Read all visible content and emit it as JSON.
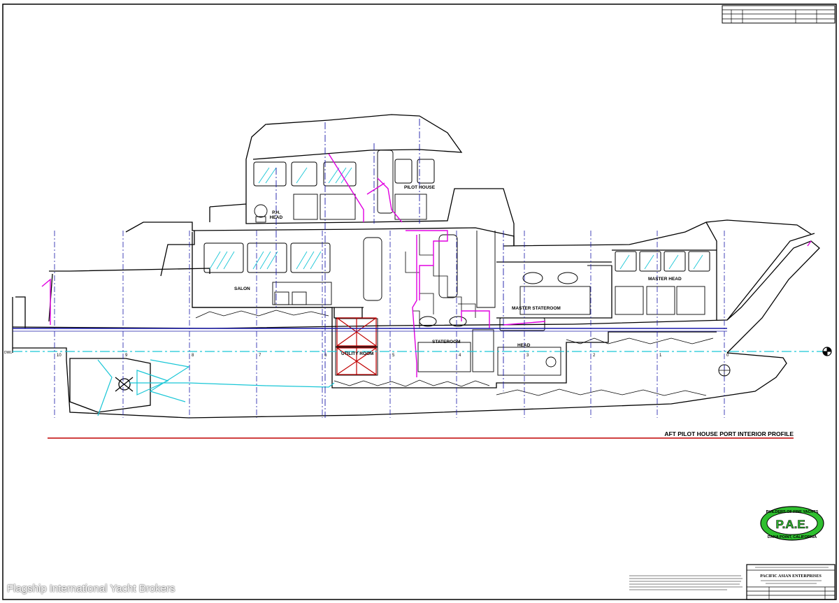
{
  "drawing": {
    "view_title": "AFT PILOT HOUSE PORT INTERIOR PROFILE",
    "rooms": {
      "pilot_house": "PILOT HOUSE",
      "ph_head": "P.H.\nHEAD",
      "salon": "SALON",
      "utility_room": "UTILITY ROOM",
      "stateroom": "STATEROOM",
      "master_stateroom": "MASTER STATEROOM",
      "master_head": "MASTER HEAD",
      "head": "HEAD"
    },
    "stations": [
      "10",
      "9",
      "8",
      "7",
      "6",
      "5",
      "4",
      "3",
      "2",
      "1",
      "0"
    ],
    "waterline_label": "DWL"
  },
  "title_block": {
    "company": "PACIFIC ASIAN ENTERPRISES"
  },
  "logo": {
    "initials": "P.A.E.",
    "ring_top": "BUILDERS OF FINE YACHTS",
    "ring_bottom": "DANA POINT, CALIFORNIA"
  },
  "watermark": "Flagship International Yacht Brokers",
  "colors": {
    "line": "#000000",
    "station": "#1a1aa8",
    "piping": "#e000e0",
    "water": "#19c6d6",
    "reference": "#c00000",
    "logo": "#2fbf2f"
  }
}
